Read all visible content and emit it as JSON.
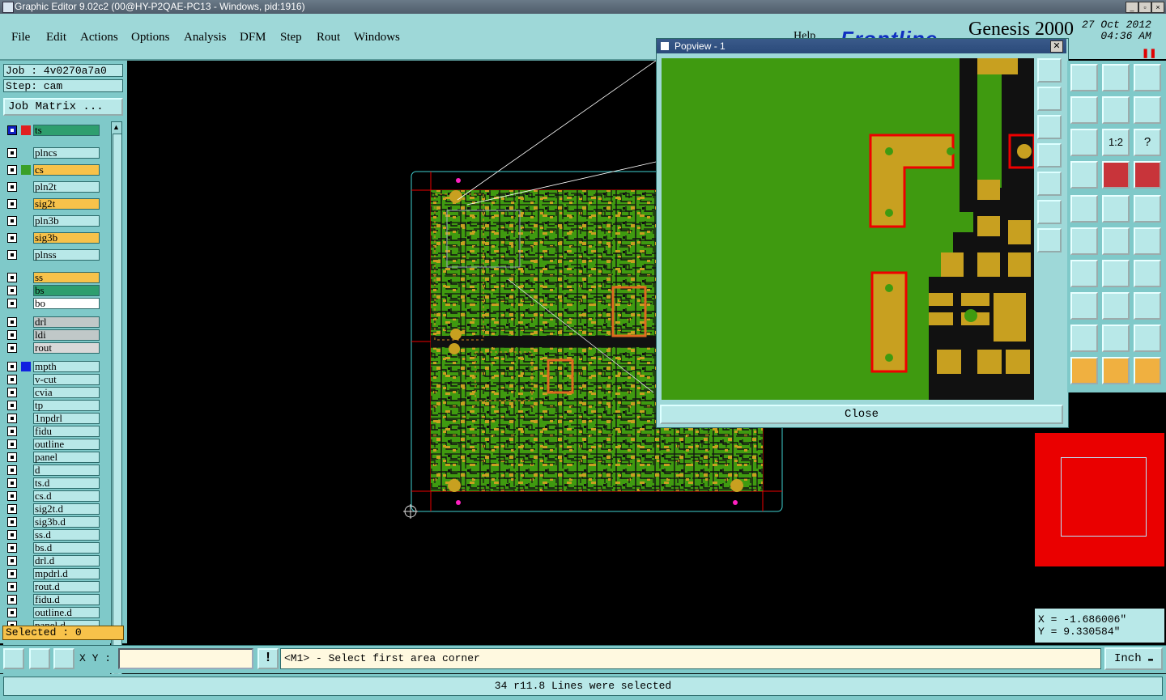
{
  "window": {
    "title": "Graphic Editor 9.02c2 (00@HY-P2QAE-PC13 - Windows, pid:1916)"
  },
  "menu": [
    "File",
    "Edit",
    "Actions",
    "Options",
    "Analysis",
    "DFM",
    "Step",
    "Rout",
    "Windows"
  ],
  "help": "Help",
  "branding": {
    "logo": "Frontline",
    "product": "Genesis 2000",
    "date": "27 Oct 2012",
    "time": "04:36 AM"
  },
  "job": {
    "job_label": "Job : 4v0270a7a0",
    "step_label": "Step: cam",
    "matrix_button": "Job Matrix ..."
  },
  "layers": [
    {
      "name": "ts",
      "color": "#2e9e6e",
      "swatch": "#e02020",
      "active": true
    },
    {
      "name": "plncs",
      "color": "#b8e8e8"
    },
    {
      "name": "cs",
      "color": "#f7c24a",
      "swatch": "#3aa028"
    },
    {
      "name": "pln2t",
      "color": "#b8e8e8"
    },
    {
      "name": "sig2t",
      "color": "#f7c24a"
    },
    {
      "name": "pln3b",
      "color": "#b8e8e8"
    },
    {
      "name": "sig3b",
      "color": "#f7c24a"
    },
    {
      "name": "plnss",
      "color": "#b8e8e8"
    },
    {
      "name": "ss",
      "color": "#f7c24a"
    },
    {
      "name": "bs",
      "color": "#2e9e6e"
    },
    {
      "name": "bo",
      "color": "#ffffff"
    },
    {
      "name": "drl",
      "color": "#c0c8c8"
    },
    {
      "name": "ldi",
      "color": "#c0c8c8"
    },
    {
      "name": "rout",
      "color": "#d8d8d8"
    },
    {
      "name": "mpth",
      "color": "#b8e8e8",
      "swatch": "#1020e0"
    },
    {
      "name": "v-cut",
      "color": "#b8e8e8"
    },
    {
      "name": "cvia",
      "color": "#b8e8e8"
    },
    {
      "name": "tp",
      "color": "#b8e8e8"
    },
    {
      "name": "1npdrl",
      "color": "#b8e8e8"
    },
    {
      "name": "fidu",
      "color": "#b8e8e8"
    },
    {
      "name": "outline",
      "color": "#b8e8e8"
    },
    {
      "name": "panel",
      "color": "#b8e8e8"
    },
    {
      "name": "d",
      "color": "#b8e8e8"
    },
    {
      "name": "ts.d",
      "color": "#b8e8e8"
    },
    {
      "name": "cs.d",
      "color": "#b8e8e8"
    },
    {
      "name": "sig2t.d",
      "color": "#b8e8e8"
    },
    {
      "name": "sig3b.d",
      "color": "#b8e8e8"
    },
    {
      "name": "ss.d",
      "color": "#b8e8e8"
    },
    {
      "name": "bs.d",
      "color": "#b8e8e8"
    },
    {
      "name": "drl.d",
      "color": "#b8e8e8"
    },
    {
      "name": "mpdrl.d",
      "color": "#b8e8e8"
    },
    {
      "name": "rout.d",
      "color": "#b8e8e8"
    },
    {
      "name": "fidu.d",
      "color": "#b8e8e8"
    },
    {
      "name": "outline.d",
      "color": "#b8e8e8"
    },
    {
      "name": "panel.d",
      "color": "#b8e8e8"
    }
  ],
  "selected": "Selected : 0",
  "popview": {
    "title": "Popview - 1",
    "close_label": "Close"
  },
  "coords": {
    "x": "X = -1.686006\"",
    "y": "Y = 9.330584\""
  },
  "bottom": {
    "xy_label": "X Y :",
    "xy_value": "",
    "prompt": "<M1> - Select first area corner",
    "unit": "Inch"
  },
  "status": "34 r11.8 Lines were selected",
  "colors": {
    "board": "#3f9a10",
    "pad": "#c8a020",
    "panel_bg": "#7fc9c9",
    "accent": "#ea0000"
  }
}
